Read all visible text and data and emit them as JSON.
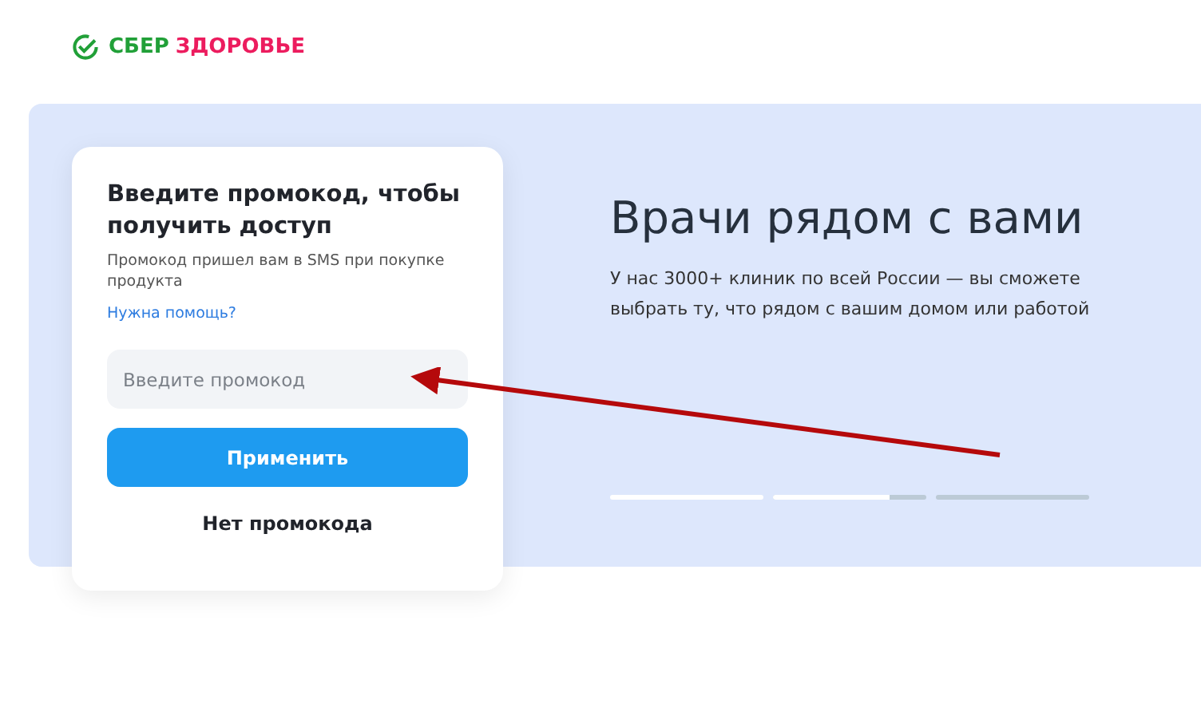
{
  "logo": {
    "brand": "СБЕР",
    "product": "ЗДОРОВЬЕ"
  },
  "promo_card": {
    "title": "Введите промокод, чтобы получить доступ",
    "hint": "Промокод пришел вам в SMS при покупке продукта",
    "help_link": "Нужна помощь?",
    "promo_field": {
      "placeholder": "Введите промокод"
    },
    "apply_button": "Применить",
    "no_code_button": "Нет промокода"
  },
  "banner": {
    "title": "Врачи рядом с вами",
    "text": "У нас 3000+ клиник по всей России — вы сможете выбрать ту, что рядом с вашим домом или работой",
    "slides": [
      {
        "kind": "viewed"
      },
      {
        "kind": "current",
        "level": 0.76
      },
      {
        "kind": "upcoming"
      }
    ]
  }
}
